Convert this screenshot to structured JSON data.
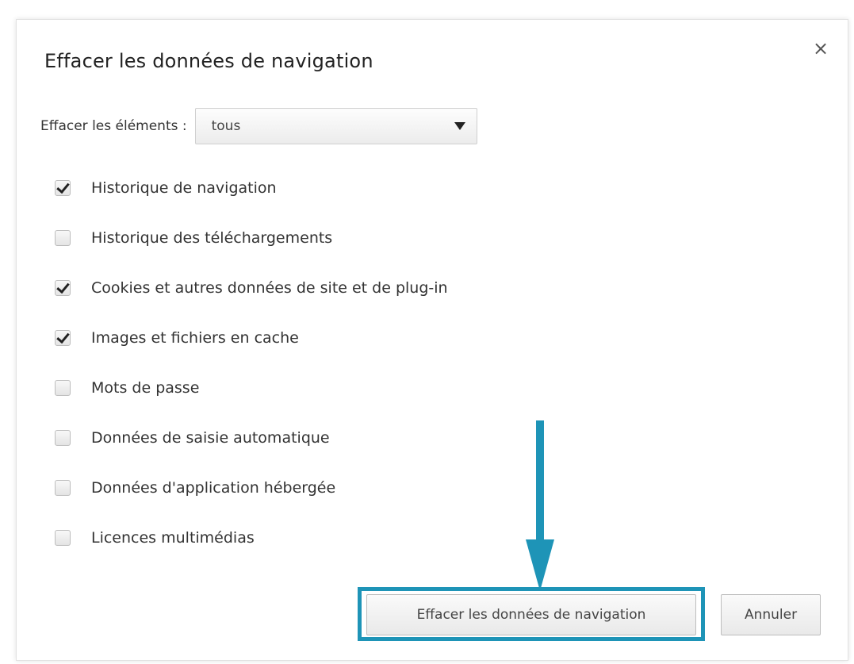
{
  "dialog": {
    "title": "Effacer les données de navigation",
    "close_symbol": "×",
    "range_label": "Effacer les éléments :",
    "range_value": "tous",
    "options": [
      {
        "label": "Historique de navigation",
        "checked": true
      },
      {
        "label": "Historique des téléchargements",
        "checked": false
      },
      {
        "label": "Cookies et autres données de site et de plug-in",
        "checked": true
      },
      {
        "label": "Images et fichiers en cache",
        "checked": true
      },
      {
        "label": "Mots de passe",
        "checked": false
      },
      {
        "label": "Données de saisie automatique",
        "checked": false
      },
      {
        "label": "Données d'application hébergée",
        "checked": false
      },
      {
        "label": "Licences multimédias",
        "checked": false
      }
    ],
    "clear_button": "Effacer les données de navigation",
    "cancel_button": "Annuler"
  },
  "colors": {
    "highlight": "#1e94b7",
    "arrow": "#1e94b7"
  }
}
